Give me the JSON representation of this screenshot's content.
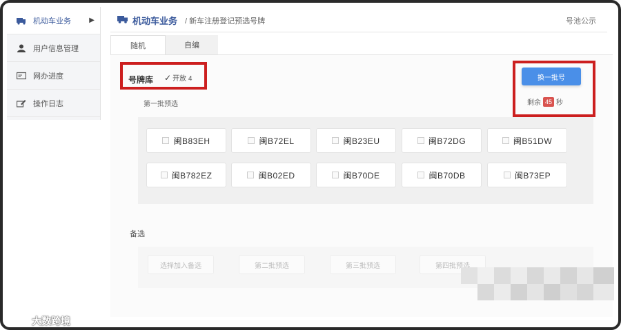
{
  "sidebar": {
    "items": [
      {
        "label": "机动车业务",
        "icon": "truck-icon",
        "active": true
      },
      {
        "label": "用户信息管理",
        "icon": "user-icon",
        "active": false
      },
      {
        "label": "网办进度",
        "icon": "card-icon",
        "active": false
      },
      {
        "label": "操作日志",
        "icon": "edit-icon",
        "active": false
      }
    ]
  },
  "header": {
    "title": "机动车业务",
    "breadcrumb": "/ 新车注册登记预选号牌",
    "notice": "号池公示"
  },
  "tabs": [
    {
      "label": "随机",
      "active": true
    },
    {
      "label": "自编",
      "active": false
    }
  ],
  "plate_library": {
    "label": "号牌库",
    "value": "开放 4"
  },
  "refresh": {
    "button_label": "换一批号",
    "countdown_prefix": "剩余",
    "countdown_value": "45",
    "countdown_suffix": "秒"
  },
  "group": {
    "label": "第一批预选",
    "plates": [
      [
        "闽B83EH",
        "闽B72EL",
        "闽B23EU",
        "闽B72DG",
        "闽B51DW"
      ],
      [
        "闽B782EZ",
        "闽B02ED",
        "闽B70DE",
        "闽B70DB",
        "闽B73EP"
      ]
    ]
  },
  "backup": {
    "label": "备选",
    "buttons": [
      "选择加入备选",
      "第二批预选",
      "第三批预选",
      "第四批预选"
    ]
  },
  "watermark": "大数跨境",
  "colors": {
    "accent": "#3b5a9c",
    "button": "#4a8fe8",
    "highlight": "#cc1f1f",
    "badge": "#d9534f"
  }
}
